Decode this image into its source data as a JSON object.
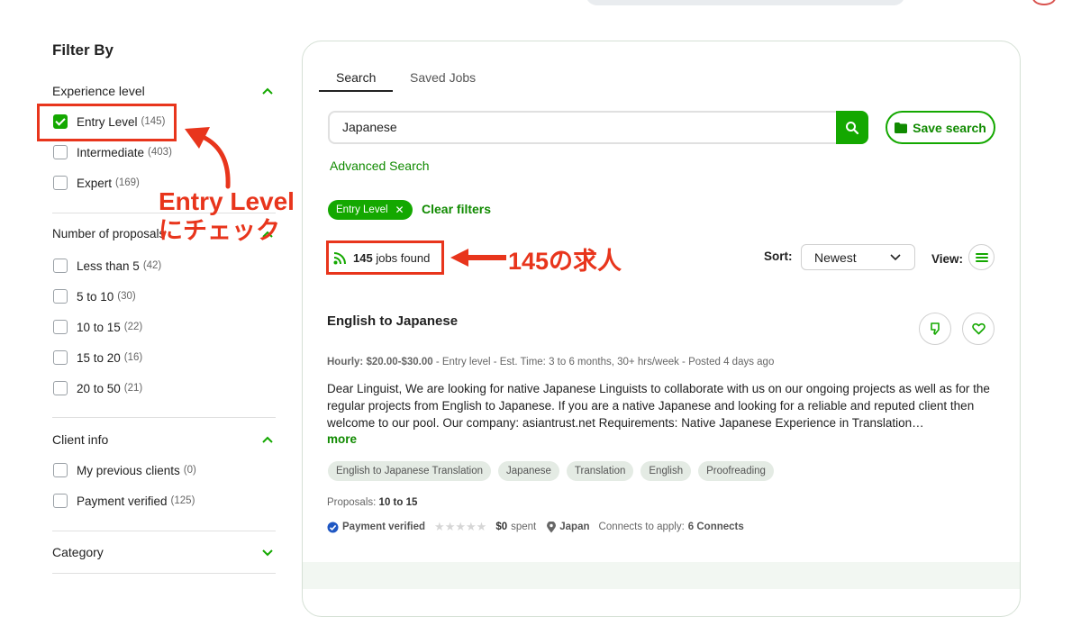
{
  "sidebar": {
    "title": "Filter By",
    "experience": {
      "title": "Experience level",
      "options": [
        {
          "label": "Entry Level",
          "count": "(145)",
          "checked": true
        },
        {
          "label": "Intermediate",
          "count": "(403)",
          "checked": false
        },
        {
          "label": "Expert",
          "count": "(169)",
          "checked": false
        }
      ]
    },
    "proposals": {
      "title": "Number of proposals",
      "options": [
        {
          "label": "Less than 5",
          "count": "(42)"
        },
        {
          "label": "5 to 10",
          "count": "(30)"
        },
        {
          "label": "10 to 15",
          "count": "(22)"
        },
        {
          "label": "15 to 20",
          "count": "(16)"
        },
        {
          "label": "20 to 50",
          "count": "(21)"
        }
      ]
    },
    "client": {
      "title": "Client info",
      "options": [
        {
          "label": "My previous clients",
          "count": "(0)"
        },
        {
          "label": "Payment verified",
          "count": "(125)"
        }
      ]
    },
    "category": {
      "title": "Category"
    }
  },
  "tabs": {
    "search": "Search",
    "saved": "Saved Jobs"
  },
  "search": {
    "value": "Japanese",
    "save_label": "Save search",
    "advanced": "Advanced Search"
  },
  "filters": {
    "chip": "Entry Level",
    "clear": "Clear filters"
  },
  "results": {
    "count": "145",
    "suffix": "jobs found",
    "sort_label": "Sort:",
    "sort_value": "Newest",
    "view_label": "View:"
  },
  "job": {
    "title": "English to Japanese",
    "rate": "Hourly: $20.00-$30.00",
    "meta": "- Entry level - Est. Time: 3 to 6 months, 30+ hrs/week - Posted 4 days ago",
    "description": "Dear Linguist, We are looking for native Japanese Linguists to collaborate with us on our ongoing projects as well as for the regular projects from English to Japanese. If you are a native Japanese and looking for a reliable and reputed client then welcome to our pool. Our company: asiantrust.net Requirements: Native Japanese Experience in Translation…",
    "more": "more",
    "skills": [
      "English to Japanese Translation",
      "Japanese",
      "Translation",
      "English",
      "Proofreading"
    ],
    "proposals_label": "Proposals:",
    "proposals_value": "10 to 15",
    "payment": "Payment verified",
    "rating": 0,
    "spent": "$0",
    "spent_suffix": "spent",
    "country": "Japan",
    "connects_label": "Connects to apply:",
    "connects_value": "6 Connects"
  },
  "annotations": {
    "entry_line1": "Entry Level",
    "entry_line2": "にチェック",
    "jobs": "145の求人",
    "color": "#e8351c"
  },
  "colors": {
    "brand": "#14a800"
  }
}
